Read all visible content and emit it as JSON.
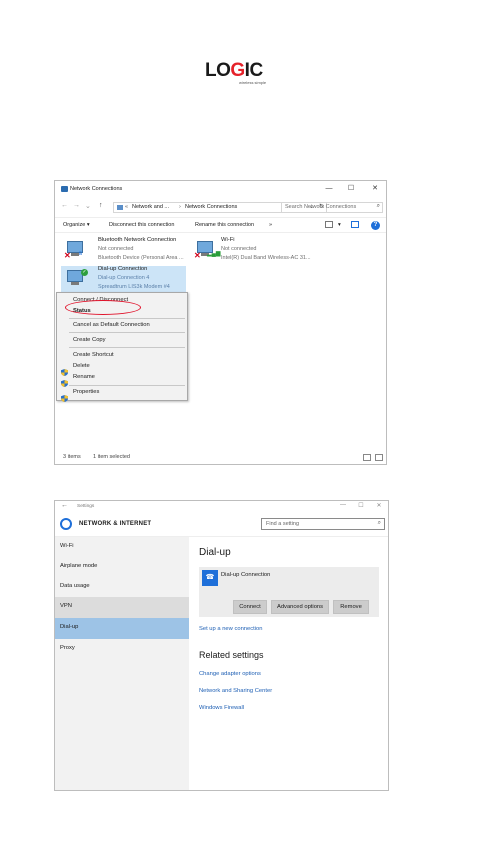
{
  "logo": {
    "text_pre": "LO",
    "text_o": "G",
    "text_post": "IC",
    "tagline": "wireless simple"
  },
  "explorer": {
    "title": "Network Connections",
    "window_buttons": {
      "min": "—",
      "max": "☐",
      "close": "✕"
    },
    "address": {
      "crumb1": "Network and ...",
      "crumb2": "Network Connections",
      "sep": "›",
      "more": "«"
    },
    "search_placeholder": "Search Network Connections",
    "toolbar": {
      "organize": "Organize ▾",
      "disconnect": "Disconnect this connection",
      "rename": "Rename this connection",
      "more": "»"
    },
    "connections": [
      {
        "name": "Bluetooth Network Connection",
        "status": "Not connected",
        "device": "Bluetooth Device (Personal Area ..."
      },
      {
        "name": "Wi-Fi",
        "status": "Not connected",
        "device": "Intel(R) Dual Band Wireless-AC 31..."
      },
      {
        "name": "Dial-up Connection",
        "status": "Dial-up Connection 4",
        "device": "Spreadtrum LIS3k Modem #4"
      }
    ],
    "context_menu": {
      "connect": "Connect / Disconnect",
      "status": "Status",
      "cancel_default": "Cancel as Default Connection",
      "create_copy": "Create Copy",
      "create_shortcut": "Create Shortcut",
      "delete": "Delete",
      "rename": "Rename",
      "properties": "Properties"
    },
    "status": {
      "items": "3 items",
      "selected": "1 item selected"
    }
  },
  "settings": {
    "app_title": "Settings",
    "window_buttons": {
      "min": "—",
      "max": "☐",
      "close": "✕"
    },
    "heading": "NETWORK & INTERNET",
    "find_placeholder": "Find a setting",
    "sidebar": [
      "Wi-Fi",
      "Airplane mode",
      "Data usage",
      "VPN",
      "Dial-up",
      "Proxy"
    ],
    "main": {
      "title": "Dial-up",
      "connection_name": "Dial-up Connection",
      "buttons": {
        "connect": "Connect",
        "advanced": "Advanced options",
        "remove": "Remove"
      },
      "setup_link": "Set up a new connection",
      "related_title": "Related settings",
      "links": [
        "Change adapter options",
        "Network and Sharing Center",
        "Windows Firewall"
      ]
    }
  }
}
